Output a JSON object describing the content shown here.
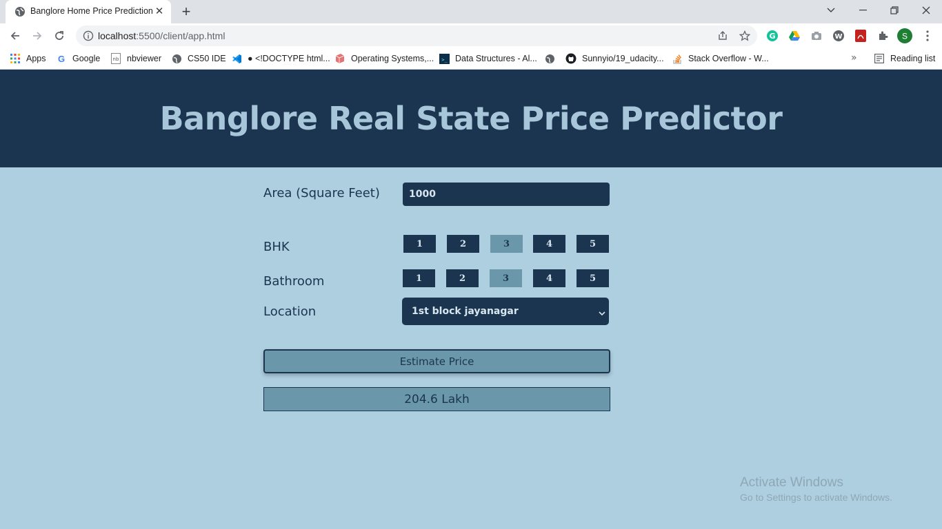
{
  "browser": {
    "tab_title": "Banglore Home Price Prediction",
    "url_host": "localhost",
    "url_rest": ":5500/client/app.html",
    "bookmarks": [
      {
        "label": "Apps",
        "icon": "apps-grid-icon"
      },
      {
        "label": "Google",
        "icon": "google-icon"
      },
      {
        "label": "nbviewer",
        "icon": "nbviewer-icon"
      },
      {
        "label": "CS50 IDE",
        "icon": "globe-icon"
      },
      {
        "label": "● <!DOCTYPE html...",
        "icon": "vscode-icon"
      },
      {
        "label": "Operating Systems,...",
        "icon": "ostep-icon"
      },
      {
        "label": "Data Structures - Al...",
        "icon": "terminal-icon"
      },
      {
        "label": "",
        "icon": "globe-icon"
      },
      {
        "label": "Sunnyio/19_udacity...",
        "icon": "github-icon"
      },
      {
        "label": "Stack Overflow - W...",
        "icon": "stackoverflow-icon"
      }
    ],
    "reading_list": "Reading list",
    "more_bookmarks": "»",
    "profile_initial": "S"
  },
  "header": {
    "title": "Banglore Real State Price Predictor"
  },
  "form": {
    "area_label": "Area (Square Feet)",
    "area_value": "1000",
    "bhk_label": "BHK",
    "bhk_options": [
      "1",
      "2",
      "3",
      "4",
      "5"
    ],
    "bhk_selected": "3",
    "bath_label": "Bathroom",
    "bath_options": [
      "1",
      "2",
      "3",
      "4",
      "5"
    ],
    "bath_selected": "3",
    "location_label": "Location",
    "location_value": "1st block jayanagar",
    "estimate_label": "Estimate Price",
    "result": "204.6 Lakh"
  },
  "watermark": {
    "title": "Activate Windows",
    "subtitle": "Go to Settings to activate Windows."
  },
  "colors": {
    "header_bg": "#1b3550",
    "page_bg": "#aecfe0",
    "accent": "#6b97aa",
    "title_text": "#a8c6d9"
  }
}
